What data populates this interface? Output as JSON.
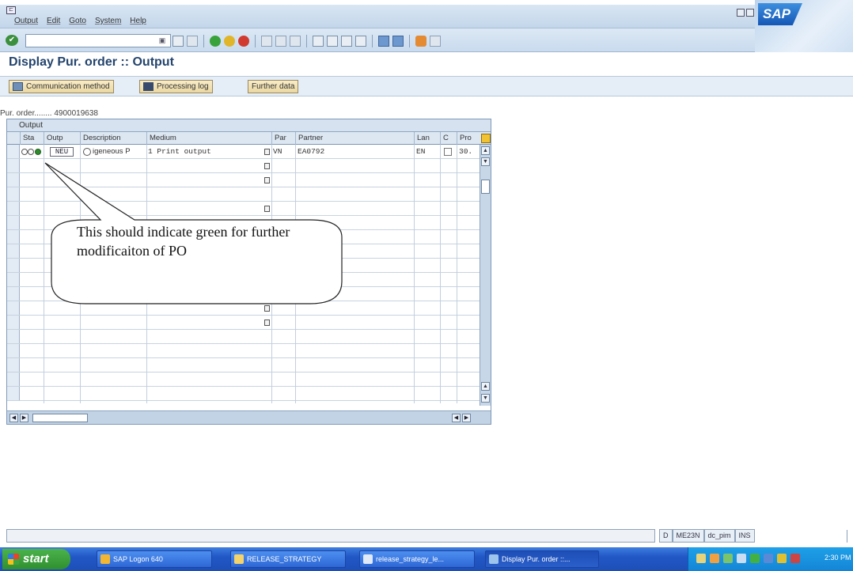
{
  "window": {
    "menu": [
      "Output",
      "Edit",
      "Goto",
      "System",
      "Help"
    ],
    "logo_text": "SAP"
  },
  "page": {
    "title": "Display Pur. order :: Output"
  },
  "app_toolbar": {
    "buttons": [
      "Communication method",
      "Processing log",
      "Further data"
    ]
  },
  "order": {
    "label": "Pur. order........",
    "number": "4900019638"
  },
  "table": {
    "caption": "Output",
    "headers": [
      "Sta",
      "Outp",
      "Description",
      "Medium",
      "Par",
      "Partner",
      "Lan",
      "C",
      "Pro"
    ],
    "rows": [
      {
        "type": "NEU",
        "description": "igeneous P",
        "medium": "1 Print output",
        "par": "VN",
        "partner": "EA0792",
        "lan": "EN",
        "processing": "30."
      }
    ]
  },
  "callout": {
    "text": "This should indicate green for further modificaiton of PO"
  },
  "status": {
    "items": [
      "D",
      "ME23N",
      "dc_pim",
      "INS"
    ]
  },
  "taskbar": {
    "start": "start",
    "tasks": [
      "SAP Logon 640",
      "RELEASE_STRATEGY",
      "release_strategy_le...",
      "Display Pur. order ::..."
    ],
    "clock": "2:30 PM"
  },
  "colors": {
    "sap_blue": "#1557b5",
    "title": "#23446d",
    "status_lamp": "#2e8b2e"
  }
}
